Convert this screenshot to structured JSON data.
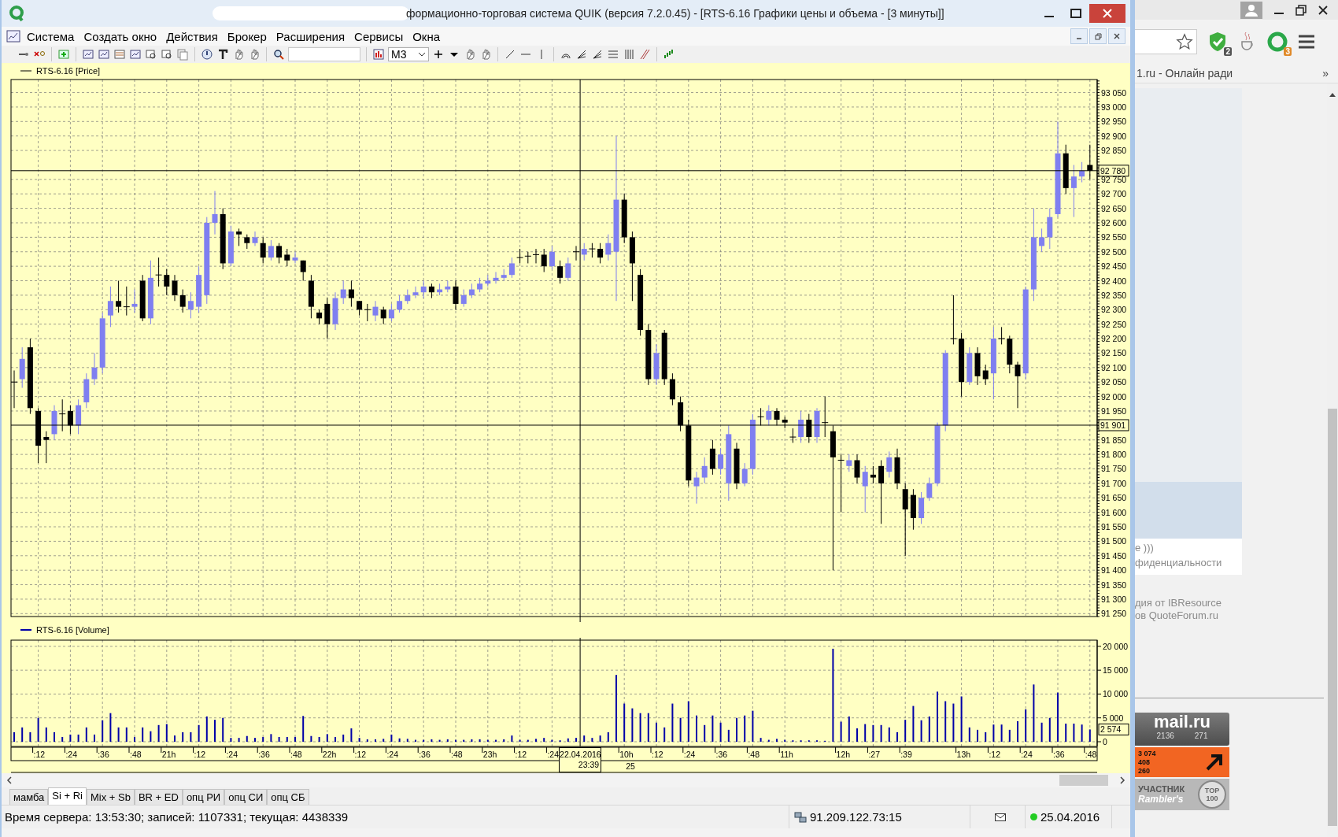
{
  "window": {
    "title": "формационно-торговая система QUIK (версия 7.2.0.45) - [RTS-6.16 Графики цены и объема - [3 минуты]]"
  },
  "menu": [
    "Система",
    "Создать окно",
    "Действия",
    "Брокер",
    "Расширения",
    "Сервисы",
    "Окна"
  ],
  "toolbar": {
    "interval": "M3"
  },
  "price_panel": {
    "chart_data": {
      "type": "candlestick",
      "title": "RTS-6.16 [Price]",
      "grid": true,
      "ylim": [
        91240,
        93095
      ],
      "yticks": [
        {
          "value": 93050,
          "label": "93 050"
        },
        {
          "value": 93000,
          "label": "93 000"
        },
        {
          "value": 92950,
          "label": "92 950"
        },
        {
          "value": 92900,
          "label": "92 900"
        },
        {
          "value": 92850,
          "label": "92 850"
        },
        {
          "value": 92750,
          "label": "92 750"
        },
        {
          "value": 92700,
          "label": "92 700"
        },
        {
          "value": 92650,
          "label": "92 650"
        },
        {
          "value": 92600,
          "label": "92 600"
        },
        {
          "value": 92550,
          "label": "92 550"
        },
        {
          "value": 92500,
          "label": "92 500"
        },
        {
          "value": 92450,
          "label": "92 450"
        },
        {
          "value": 92400,
          "label": "92 400"
        },
        {
          "value": 92350,
          "label": "92 350"
        },
        {
          "value": 92300,
          "label": "92 300"
        },
        {
          "value": 92250,
          "label": "92 250"
        },
        {
          "value": 92200,
          "label": "92 200"
        },
        {
          "value": 92150,
          "label": "92 150"
        },
        {
          "value": 92100,
          "label": "92 100"
        },
        {
          "value": 92050,
          "label": "92 050"
        },
        {
          "value": 92000,
          "label": "92 000"
        },
        {
          "value": 91950,
          "label": "91 950"
        },
        {
          "value": 91850,
          "label": "91 850"
        },
        {
          "value": 91800,
          "label": "91 800"
        },
        {
          "value": 91750,
          "label": "91 750"
        },
        {
          "value": 91700,
          "label": "91 700"
        },
        {
          "value": 91650,
          "label": "91 650"
        },
        {
          "value": 91600,
          "label": "91 600"
        },
        {
          "value": 91550,
          "label": "91 550"
        },
        {
          "value": 91500,
          "label": "91 500"
        },
        {
          "value": 91450,
          "label": "91 450"
        },
        {
          "value": 91400,
          "label": "91 400"
        },
        {
          "value": 91350,
          "label": "91 350"
        },
        {
          "value": 91300,
          "label": "91 300"
        },
        {
          "value": 91250,
          "label": "91 250"
        }
      ],
      "annotations": [
        "92 780",
        "91 901"
      ],
      "ohlc": [
        [
          92050,
          92090,
          91960,
          92050
        ],
        [
          92060,
          92170,
          92030,
          92130
        ],
        [
          92170,
          92200,
          91940,
          91960
        ],
        [
          91950,
          91960,
          91770,
          91830
        ],
        [
          91860,
          91880,
          91770,
          91850
        ],
        [
          91870,
          91970,
          91850,
          91950
        ],
        [
          91940,
          91990,
          91880,
          91940
        ],
        [
          91950,
          91970,
          91870,
          91900
        ],
        [
          91900,
          91990,
          91870,
          91970
        ],
        [
          91980,
          92080,
          91960,
          92060
        ],
        [
          92060,
          92150,
          92040,
          92100
        ],
        [
          92100,
          92290,
          92080,
          92270
        ],
        [
          92280,
          92380,
          92240,
          92330
        ],
        [
          92330,
          92400,
          92290,
          92310
        ],
        [
          92310,
          92380,
          92280,
          92310
        ],
        [
          92310,
          92370,
          92290,
          92320
        ],
        [
          92400,
          92420,
          92260,
          92270
        ],
        [
          92270,
          92470,
          92250,
          92410
        ],
        [
          92420,
          92480,
          92380,
          92420
        ],
        [
          92420,
          92440,
          92350,
          92380
        ],
        [
          92400,
          92420,
          92330,
          92350
        ],
        [
          92350,
          92370,
          92290,
          92310
        ],
        [
          92300,
          92360,
          92270,
          92330
        ],
        [
          92310,
          92450,
          92290,
          92420
        ],
        [
          92350,
          92620,
          92320,
          92600
        ],
        [
          92600,
          92710,
          92560,
          92630
        ],
        [
          92630,
          92650,
          92440,
          92460
        ],
        [
          92460,
          92590,
          92450,
          92570
        ],
        [
          92570,
          92580,
          92520,
          92560
        ],
        [
          92550,
          92560,
          92510,
          92530
        ],
        [
          92530,
          92570,
          92520,
          92550
        ],
        [
          92530,
          92550,
          92460,
          92480
        ],
        [
          92480,
          92540,
          92470,
          92520
        ],
        [
          92520,
          92530,
          92460,
          92480
        ],
        [
          92490,
          92510,
          92450,
          92470
        ],
        [
          92470,
          92500,
          92460,
          92480
        ],
        [
          92470,
          92470,
          92400,
          92430
        ],
        [
          92400,
          92420,
          92270,
          92310
        ],
        [
          92290,
          92300,
          92250,
          92270
        ],
        [
          92320,
          92340,
          92200,
          92250
        ],
        [
          92250,
          92360,
          92230,
          92340
        ],
        [
          92340,
          92400,
          92320,
          92370
        ],
        [
          92370,
          92400,
          92310,
          92340
        ],
        [
          92330,
          92330,
          92280,
          92300
        ],
        [
          92300,
          92320,
          92260,
          92300
        ],
        [
          92280,
          92330,
          92260,
          92310
        ],
        [
          92300,
          92310,
          92250,
          92270
        ],
        [
          92270,
          92320,
          92260,
          92300
        ],
        [
          92300,
          92350,
          92290,
          92330
        ],
        [
          92330,
          92370,
          92320,
          92350
        ],
        [
          92350,
          92380,
          92340,
          92360
        ],
        [
          92360,
          92400,
          92340,
          92380
        ],
        [
          92380,
          92390,
          92340,
          92360
        ],
        [
          92360,
          92390,
          92350,
          92370
        ],
        [
          92370,
          92400,
          92360,
          92380
        ],
        [
          92380,
          92400,
          92300,
          92320
        ],
        [
          92320,
          92370,
          92310,
          92350
        ],
        [
          92350,
          92390,
          92340,
          92370
        ],
        [
          92370,
          92410,
          92360,
          92390
        ],
        [
          92390,
          92420,
          92380,
          92400
        ],
        [
          92400,
          92430,
          92390,
          92410
        ],
        [
          92410,
          92440,
          92400,
          92420
        ],
        [
          92420,
          92480,
          92410,
          92460
        ],
        [
          92480,
          92510,
          92460,
          92480
        ],
        [
          92485,
          92500,
          92460,
          92485
        ],
        [
          92490,
          92510,
          92460,
          92490
        ],
        [
          92490,
          92510,
          92430,
          92450
        ],
        [
          92450,
          92520,
          92440,
          92500
        ],
        [
          92450,
          92470,
          92390,
          92410
        ],
        [
          92410,
          92480,
          92400,
          92460
        ],
        [
          92500,
          92520,
          92470,
          92500
        ],
        [
          92490,
          92530,
          92470,
          92510
        ],
        [
          92510,
          92530,
          92480,
          92510
        ],
        [
          92510,
          92530,
          92460,
          92480
        ],
        [
          92490,
          92560,
          92470,
          92530
        ],
        [
          92500,
          92900,
          92330,
          92680
        ],
        [
          92680,
          92700,
          92530,
          92550
        ],
        [
          92550,
          92570,
          92330,
          92460
        ],
        [
          92420,
          92440,
          92210,
          92230
        ],
        [
          92230,
          92250,
          92040,
          92060
        ],
        [
          92060,
          92180,
          92040,
          92150
        ],
        [
          92220,
          92230,
          92040,
          92060
        ],
        [
          92060,
          92080,
          91970,
          91990
        ],
        [
          91980,
          92000,
          91880,
          91900
        ],
        [
          91900,
          91920,
          91690,
          91710
        ],
        [
          91690,
          91740,
          91630,
          91720
        ],
        [
          91720,
          91790,
          91700,
          91760
        ],
        [
          91820,
          91850,
          91730,
          91750
        ],
        [
          91750,
          91820,
          91730,
          91800
        ],
        [
          91700,
          91900,
          91640,
          91870
        ],
        [
          91820,
          91840,
          91680,
          91700
        ],
        [
          91700,
          91770,
          91690,
          91750
        ],
        [
          91750,
          91940,
          91730,
          91920
        ],
        [
          91930,
          91960,
          91900,
          91930
        ],
        [
          91920,
          91970,
          91900,
          91950
        ],
        [
          91950,
          91960,
          91900,
          91920
        ],
        [
          91920,
          91930,
          91890,
          91910
        ],
        [
          91860,
          91890,
          91840,
          91860
        ],
        [
          91860,
          91950,
          91840,
          91920
        ],
        [
          91920,
          91940,
          91840,
          91860
        ],
        [
          91860,
          91960,
          91840,
          91950
        ],
        [
          91910,
          92000,
          91860,
          91910
        ],
        [
          91880,
          91900,
          91400,
          91790
        ],
        [
          91780,
          91800,
          91600,
          91780
        ],
        [
          91760,
          91800,
          91740,
          91780
        ],
        [
          91780,
          91800,
          91700,
          91720
        ],
        [
          91690,
          91760,
          91600,
          91740
        ],
        [
          91730,
          91760,
          91700,
          91720
        ],
        [
          91760,
          91780,
          91560,
          91700
        ],
        [
          91740,
          91810,
          91720,
          91790
        ],
        [
          91790,
          91820,
          91680,
          91700
        ],
        [
          91680,
          91700,
          91450,
          91610
        ],
        [
          91660,
          91680,
          91540,
          91580
        ],
        [
          91580,
          91670,
          91560,
          91650
        ],
        [
          91650,
          91720,
          91640,
          91700
        ],
        [
          91700,
          91910,
          91690,
          91900
        ],
        [
          91900,
          92160,
          91880,
          92150
        ],
        [
          92200,
          92350,
          92180,
          92200
        ],
        [
          92200,
          92220,
          92000,
          92050
        ],
        [
          92050,
          92170,
          92040,
          92150
        ],
        [
          92150,
          92170,
          92040,
          92070
        ],
        [
          92090,
          92110,
          92040,
          92060
        ],
        [
          92080,
          92240,
          91990,
          92200
        ],
        [
          92200,
          92240,
          92180,
          92200
        ],
        [
          92200,
          92210,
          92080,
          92110
        ],
        [
          92110,
          92120,
          91960,
          92070
        ],
        [
          92080,
          92380,
          92060,
          92370
        ],
        [
          92370,
          92650,
          92330,
          92550
        ],
        [
          92520,
          92580,
          92500,
          92550
        ],
        [
          92550,
          92650,
          92510,
          92620
        ],
        [
          92630,
          92950,
          92620,
          92840
        ],
        [
          92840,
          92870,
          92700,
          92720
        ],
        [
          92720,
          92800,
          92620,
          92760
        ],
        [
          92760,
          92810,
          92740,
          92780
        ],
        [
          92800,
          92870,
          92750,
          92780
        ]
      ]
    }
  },
  "volume_panel": {
    "chart_data": {
      "type": "bar",
      "title": "RTS-6.16 [Volume]",
      "grid": true,
      "ylim": [
        0,
        21300
      ],
      "yticks": [
        {
          "value": 20000,
          "label": "20 000"
        },
        {
          "value": 15000,
          "label": "15 000"
        },
        {
          "value": 10000,
          "label": "10 000"
        },
        {
          "value": 5000,
          "label": "5 000"
        },
        {
          "value": 0,
          "label": "0"
        }
      ],
      "categories": [
        null,
        null,
        null,
        ":12",
        null,
        null,
        null,
        ":24",
        null,
        null,
        null,
        ":36",
        null,
        null,
        null,
        ":48",
        null,
        null,
        null,
        "21h",
        null,
        null,
        null,
        ":12",
        null,
        null,
        null,
        ":24",
        null,
        null,
        null,
        ":36",
        null,
        null,
        null,
        ":48",
        null,
        null,
        null,
        "22h",
        null,
        null,
        null,
        ":12",
        null,
        null,
        null,
        ":24",
        null,
        null,
        null,
        ":36",
        null,
        null,
        null,
        ":48",
        null,
        null,
        null,
        "23h",
        null,
        null,
        null,
        ":12",
        null,
        null,
        null,
        ":24",
        null,
        null,
        null,
        null,
        null,
        null,
        null,
        null,
        "10h",
        null,
        null,
        null,
        ":12",
        null,
        null,
        null,
        ":24",
        null,
        null,
        null,
        ":36",
        null,
        null,
        null,
        ":48",
        null,
        null,
        null,
        "11h",
        null,
        null,
        null,
        null,
        null,
        null,
        "12h",
        null,
        null,
        null,
        ":27",
        null,
        null,
        null,
        ":39",
        null,
        null,
        null,
        null,
        null,
        null,
        "13h",
        null,
        null,
        null,
        ":12",
        null,
        null,
        null,
        ":24",
        null,
        null,
        null,
        ":36",
        null,
        null,
        null,
        ":48"
      ],
      "annotations": [
        "2 574",
        "22.04.2016 23:39",
        "25"
      ],
      "values": [
        2000,
        3000,
        2000,
        5000,
        3000,
        2000,
        1000,
        1500,
        1500,
        3000,
        1500,
        4500,
        6000,
        3000,
        3000,
        1000,
        3000,
        2200,
        3500,
        3700,
        1300,
        2000,
        2000,
        3500,
        5300,
        4600,
        5000,
        800,
        800,
        1200,
        800,
        1000,
        1600,
        1000,
        1000,
        1000,
        5400,
        1200,
        1000,
        1600,
        1000,
        1500,
        2800,
        800,
        500,
        500,
        600,
        1500,
        700,
        600,
        400,
        400,
        500,
        400,
        500,
        400,
        400,
        500,
        500,
        400,
        400,
        500,
        1300,
        400,
        400,
        600,
        800,
        400,
        300,
        700,
        800,
        1300,
        800,
        1300,
        2000,
        14000,
        8000,
        7000,
        6000,
        6000,
        4000,
        3000,
        8000,
        5000,
        8500,
        5500,
        3500,
        5500,
        4000,
        2500,
        5000,
        5500,
        6500,
        800,
        400,
        600,
        400,
        300,
        300,
        300,
        300,
        200,
        19500,
        4200,
        5300,
        2800,
        3700,
        3500,
        3500,
        3000,
        2000,
        4600,
        7500,
        4500,
        5300,
        10500,
        8500,
        8000,
        9500,
        3000,
        2500,
        2000,
        3600,
        3600,
        2500,
        4300,
        6800,
        12000,
        4000,
        5000,
        10300,
        3800,
        3800,
        3600,
        2574
      ]
    }
  },
  "tabs": [
    {
      "label": "мамба",
      "selected": false
    },
    {
      "label": "Si + Ri",
      "selected": true
    },
    {
      "label": "Mix + Sb",
      "selected": false
    },
    {
      "label": "BR + ED",
      "selected": false
    },
    {
      "label": "опц РИ",
      "selected": false
    },
    {
      "label": "опц СИ",
      "selected": false
    },
    {
      "label": "опц СБ",
      "selected": false
    }
  ],
  "status_bar": {
    "server_info": "Время сервера: 13:53:30; записей: 1107331; текущая: 4438339",
    "address": "91.209.122.73:15",
    "date": "25.04.2016"
  },
  "browser": {
    "extension_badges": [
      "2",
      "3"
    ],
    "bookmark": "1.ru - Онлайн ради",
    "bookmark_more": "»",
    "page_texts": [
      "е )))",
      "фиденциальности"
    ],
    "footer_texts": [
      "дия от IBResource",
      "ов QuoteForum.ru"
    ],
    "mail_counter": {
      "logo": "mail.ru",
      "values": [
        "2136",
        "271"
      ]
    },
    "orange_counter": [
      "3 074",
      "408",
      "260"
    ],
    "rambler": {
      "label": "УЧАСТНИК",
      "brand": "Rambler's",
      "top": "TOP",
      "rank": "100"
    }
  }
}
